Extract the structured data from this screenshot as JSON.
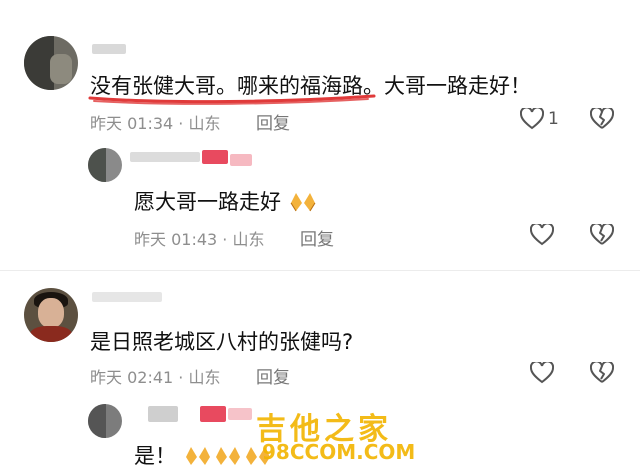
{
  "comments": [
    {
      "text": "没有张健大哥。哪来的福海路。大哥一路走好！",
      "time": "昨天 01:34 · 山东",
      "reply_label": "回复",
      "likes": "1"
    },
    {
      "text": "愿大哥一路走好",
      "time": "昨天 01:43 · 山东",
      "reply_label": "回复"
    },
    {
      "text": "是日照老城区八村的张健吗?",
      "time": "昨天 02:41 · 山东",
      "reply_label": "回复"
    },
    {
      "text": "是！"
    }
  ],
  "watermark": {
    "title": "吉他之家",
    "url": "98CCOM.COM"
  },
  "colors": {
    "underline": "#e03a3a",
    "watermark": "#f2b400",
    "meta": "#8e8e8e"
  }
}
